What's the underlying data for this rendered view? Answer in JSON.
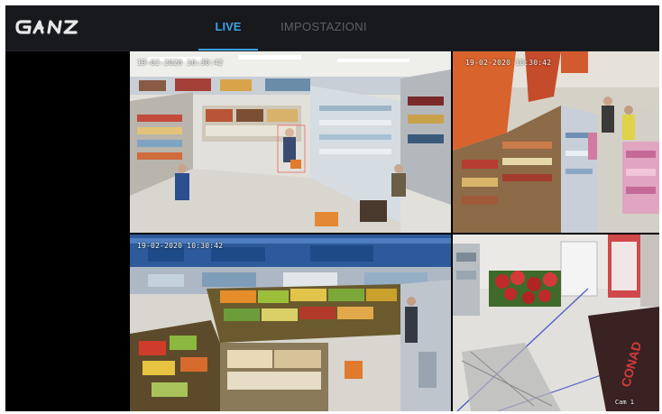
{
  "brand": {
    "logo_text": "GANZ"
  },
  "nav": {
    "tabs": [
      {
        "label": "LIVE",
        "active": true
      },
      {
        "label": "IMPOSTAZIONI",
        "active": false
      }
    ],
    "accent_color": "#3ea0e2",
    "inactive_color": "#5c6068"
  },
  "cameras": [
    {
      "timestamp": "19-02-2020 10:30:42",
      "label": ""
    },
    {
      "timestamp": "19-02-2020 10:30:42",
      "label": ""
    },
    {
      "timestamp": "19-02-2020 10:30:42",
      "label": ""
    },
    {
      "timestamp": "",
      "label": "Cam 1"
    }
  ],
  "theme": {
    "topbar_bg": "#17191d",
    "body_bg": "#000000"
  }
}
